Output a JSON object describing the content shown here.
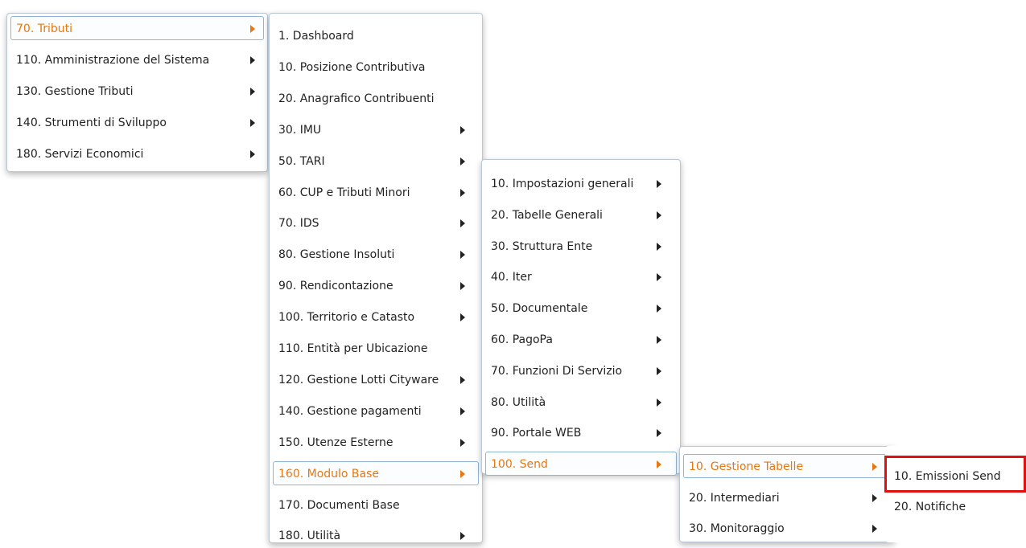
{
  "menus": [
    {
      "items": [
        {
          "label": "70. Tributi",
          "submenu": true,
          "active": true
        },
        {
          "label": "110. Amministrazione del Sistema",
          "submenu": true
        },
        {
          "label": "130. Gestione Tributi",
          "submenu": true
        },
        {
          "label": "140. Strumenti di Sviluppo",
          "submenu": true
        },
        {
          "label": "180. Servizi Economici",
          "submenu": true
        }
      ]
    },
    {
      "items": [
        {
          "label": "1. Dashboard",
          "submenu": false
        },
        {
          "label": "10. Posizione Contributiva",
          "submenu": false
        },
        {
          "label": "20. Anagrafico Contribuenti",
          "submenu": false
        },
        {
          "label": "30. IMU",
          "submenu": true
        },
        {
          "label": "50. TARI",
          "submenu": true
        },
        {
          "label": "60. CUP e Tributi Minori",
          "submenu": true
        },
        {
          "label": "70. IDS",
          "submenu": true
        },
        {
          "label": "80. Gestione Insoluti",
          "submenu": true
        },
        {
          "label": "90. Rendicontazione",
          "submenu": true
        },
        {
          "label": "100. Territorio e Catasto",
          "submenu": true
        },
        {
          "label": "110. Entità per Ubicazione",
          "submenu": false
        },
        {
          "label": "120. Gestione Lotti Cityware",
          "submenu": true
        },
        {
          "label": "140. Gestione pagamenti",
          "submenu": true
        },
        {
          "label": "150. Utenze Esterne",
          "submenu": true
        },
        {
          "label": "160. Modulo Base",
          "submenu": true,
          "active": true
        },
        {
          "label": "170. Documenti Base",
          "submenu": false
        },
        {
          "label": "180. Utilità",
          "submenu": true
        }
      ]
    },
    {
      "items": [
        {
          "label": "10. Impostazioni generali",
          "submenu": true
        },
        {
          "label": "20. Tabelle Generali",
          "submenu": true
        },
        {
          "label": "30. Struttura Ente",
          "submenu": true
        },
        {
          "label": "40. Iter",
          "submenu": true
        },
        {
          "label": "50. Documentale",
          "submenu": true
        },
        {
          "label": "60. PagoPa",
          "submenu": true
        },
        {
          "label": "70. Funzioni Di Servizio",
          "submenu": true
        },
        {
          "label": "80. Utilità",
          "submenu": true
        },
        {
          "label": "90. Portale WEB",
          "submenu": true
        },
        {
          "label": "100. Send",
          "submenu": true,
          "active": true
        }
      ]
    },
    {
      "items": [
        {
          "label": "10. Gestione Tabelle",
          "submenu": true,
          "active": true
        },
        {
          "label": "20. Intermediari",
          "submenu": true
        },
        {
          "label": "30. Monitoraggio",
          "submenu": true
        }
      ]
    },
    {
      "items": [
        {
          "label": "10. Emissioni Send",
          "submenu": false,
          "highlighted": true
        },
        {
          "label": "20. Notifiche",
          "submenu": false
        }
      ]
    }
  ],
  "colors": {
    "active_text": "#e8770f",
    "highlight_border": "#e01010"
  }
}
